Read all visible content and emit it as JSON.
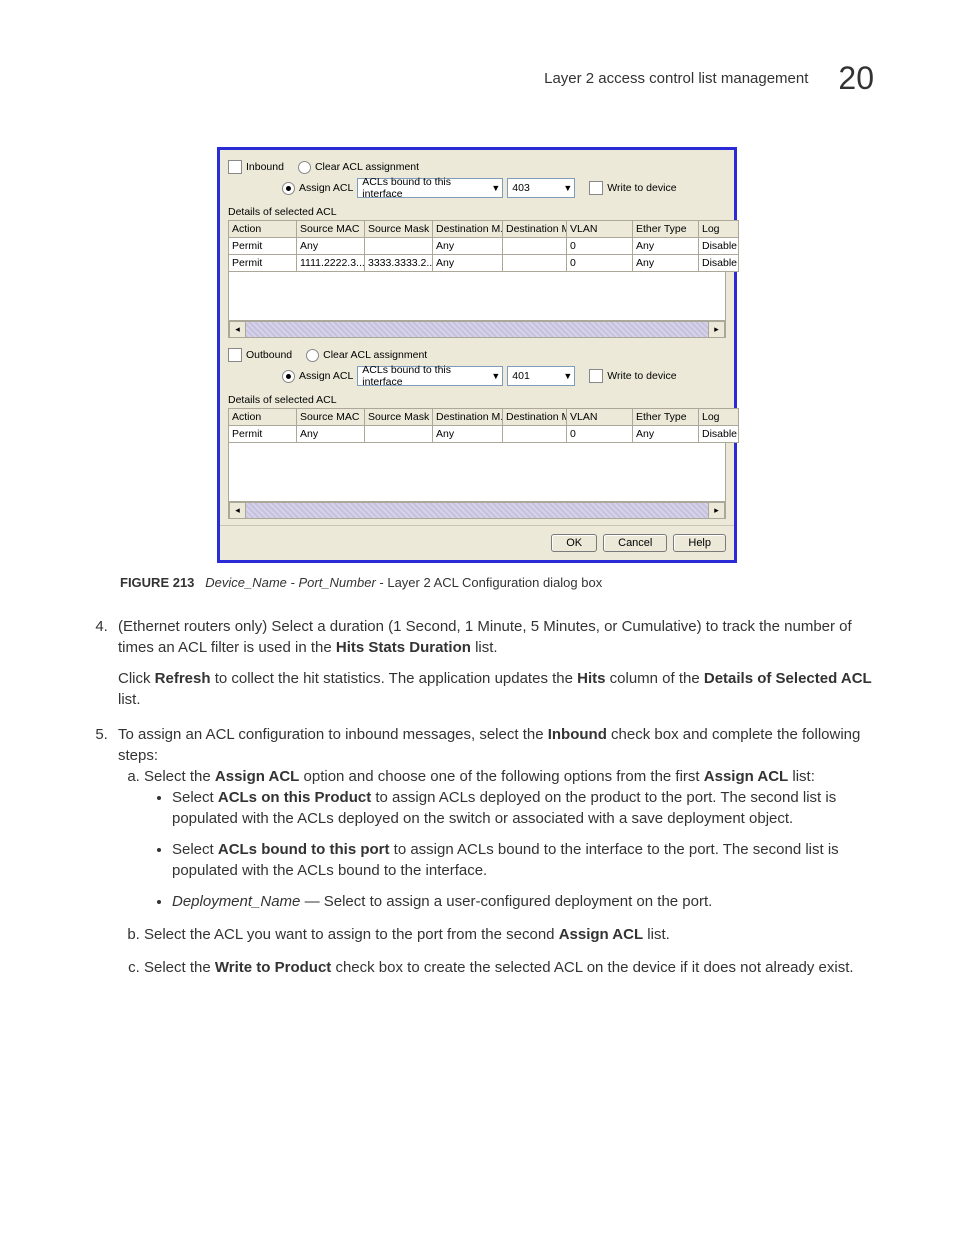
{
  "header": {
    "section": "Layer 2 access control list management",
    "chapter": "20"
  },
  "dialog": {
    "inbound": {
      "checkbox_label": "Inbound",
      "clear_label": "Clear ACL assignment",
      "assign_label": "Assign ACL",
      "dd1": "ACLs bound to this interface",
      "dd2": "403",
      "write_label": "Write to device",
      "details_title": "Details of selected ACL",
      "columns": [
        "Action",
        "Source MAC",
        "Source Mask",
        "Destination M...",
        "Destination M...",
        "VLAN",
        "Ether Type",
        "Log"
      ],
      "rows": [
        {
          "action": "Permit",
          "smac": "Any",
          "smask": "",
          "dmac": "Any",
          "dmask": "",
          "vlan": "0",
          "ether": "Any",
          "log": "Disable"
        },
        {
          "action": "Permit",
          "smac": "1111.2222.3...",
          "smask": "3333.3333.2...",
          "dmac": "Any",
          "dmask": "",
          "vlan": "0",
          "ether": "Any",
          "log": "Disable"
        }
      ]
    },
    "outbound": {
      "checkbox_label": "Outbound",
      "clear_label": "Clear ACL assignment",
      "assign_label": "Assign ACL",
      "dd1": "ACLs bound to this interface",
      "dd2": "401",
      "write_label": "Write to device",
      "details_title": "Details of selected ACL",
      "columns": [
        "Action",
        "Source MAC",
        "Source Mask",
        "Destination M...",
        "Destination M...",
        "VLAN",
        "Ether Type",
        "Log"
      ],
      "rows": [
        {
          "action": "Permit",
          "smac": "Any",
          "smask": "",
          "dmac": "Any",
          "dmask": "",
          "vlan": "0",
          "ether": "Any",
          "log": "Disable"
        }
      ]
    },
    "buttons": {
      "ok": "OK",
      "cancel": "Cancel",
      "help": "Help"
    }
  },
  "figure": {
    "label": "FIGURE 213",
    "ital": "Device_Name - Port_Number",
    "rest": " - Layer 2 ACL Configuration dialog box"
  },
  "steps": {
    "s4a": "(Ethernet routers only) Select a duration (1 Second, 1 Minute, 5 Minutes, or Cumulative) to track the number of times an ACL filter is used in the ",
    "s4b": "Hits Stats Duration",
    "s4c": " list.",
    "s4p_a": "Click ",
    "s4p_b": "Refresh",
    "s4p_c": " to collect the hit statistics. The application updates the ",
    "s4p_d": "Hits",
    "s4p_e": " column of the ",
    "s4p_f": "Details of Selected ACL",
    "s4p_g": " list.",
    "s5a": "To assign an ACL configuration to inbound messages, select the ",
    "s5b": "Inbound",
    "s5c": " check box and complete the following steps:",
    "aa1": "Select the ",
    "aa2": "Assign ACL",
    "aa3": " option and choose one of the following options from the first ",
    "aa4": "Assign ACL",
    "aa5": " list:",
    "b1a": "Select ",
    "b1b": "ACLs on this Product",
    "b1c": " to assign ACLs deployed on the product to the port. The second list is populated with the ACLs deployed on the switch or associated with a save deployment object.",
    "b2a": "Select ",
    "b2b": "ACLs bound to this port",
    "b2c": " to assign ACLs bound to the interface to the port. The second list is populated with the ACLs bound to the interface.",
    "b3a": "Deployment_Name",
    "b3b": " — Select to assign a user-configured deployment on the port.",
    "lb1": "Select the ACL you want to assign to the port from the second ",
    "lb2": "Assign ACL",
    "lb3": " list.",
    "lc1": "Select the ",
    "lc2": "Write to Product",
    "lc3": " check box to create the selected ACL on the device if it does not already exist."
  }
}
